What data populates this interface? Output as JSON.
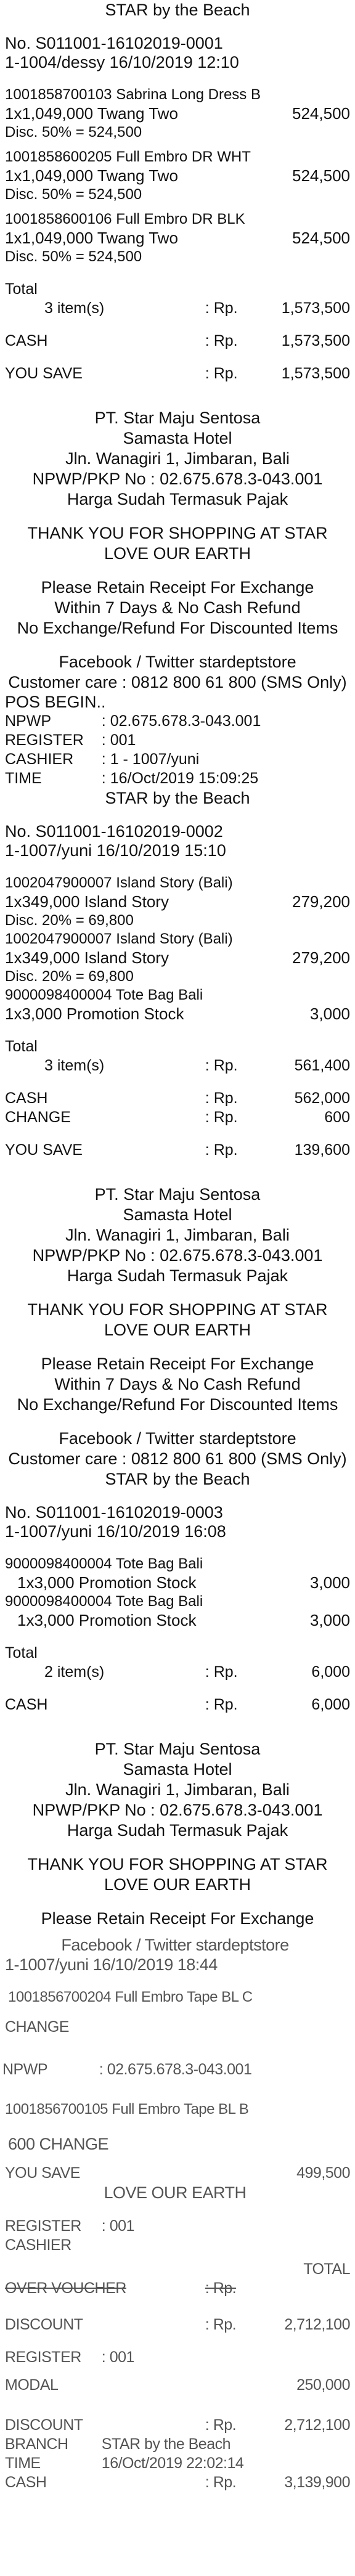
{
  "header_store": "STAR by the Beach",
  "sale1": {
    "no": "No. S011001-16102019-0001",
    "cashier_line": "1-1004/dessy      16/10/2019 12:10",
    "items": [
      {
        "code": "1001858700103 Sabrina Long Dress B",
        "qty_line": "1x1,049,000 Twang Two",
        "amount": "524,500",
        "disc": "Disc. 50% = 524,500"
      },
      {
        "code": "1001858600205 Full Embro DR WHT",
        "qty_line": "1x1,049,000 Twang Two",
        "amount": "524,500",
        "disc": "Disc. 50% = 524,500"
      },
      {
        "code": "1001858600106 Full Embro DR BLK",
        "qty_line": "1x1,049,000 Twang Two",
        "amount": "524,500",
        "disc": "Disc. 50% = 524,500"
      }
    ],
    "total_label": "Total",
    "total_count": "3 item(s)",
    "rp": ": Rp.",
    "total": "1,573,500",
    "cash_label": "CASH",
    "cash": "1,573,500",
    "yousave_label": "YOU SAVE",
    "yousave": "1,573,500"
  },
  "footer1": {
    "company": "PT. Star Maju Sentosa",
    "hotel": "Samasta Hotel",
    "address": "Jln. Wanagiri 1, Jimbaran, Bali",
    "npwp": "NPWP/PKP No : 02.675.678.3-043.001",
    "tax": "Harga Sudah Termasuk Pajak",
    "thanks1": "THANK YOU FOR SHOPPING AT STAR",
    "thanks2": "LOVE OUR EARTH",
    "retain1": "Please Retain Receipt For Exchange",
    "retain2": "Within 7 Days & No Cash Refund",
    "retain3": "No Exchange/Refund For Discounted Items",
    "social": "Facebook / Twitter stardeptstore",
    "care": "Customer care : 0812 800 61 800 (SMS Only)"
  },
  "posbegin": {
    "title": "POS BEGIN..",
    "rows": [
      {
        "k": "NPWP",
        "v": ": 02.675.678.3-043.001"
      },
      {
        "k": "REGISTER",
        "v": ": 001"
      },
      {
        "k": "CASHIER",
        "v": ": 1 - 1007/yuni"
      },
      {
        "k": "TIME",
        "v": ": 16/Oct/2019 15:09:25"
      }
    ],
    "store": "STAR by the Beach"
  },
  "sale2": {
    "no": "No. S011001-16102019-0002",
    "cashier_line": "1-1007/yuni      16/10/2019 15:10",
    "items": [
      {
        "code": "1002047900007 Island Story (Bali)",
        "qty_line": "1x349,000 Island Story",
        "amount": "279,200",
        "disc": "Disc. 20% = 69,800"
      },
      {
        "code": "1002047900007 Island Story (Bali)",
        "qty_line": "1x349,000 Island Story",
        "amount": "279,200",
        "disc": "Disc. 20% = 69,800"
      },
      {
        "code": "9000098400004 Tote Bag Bali",
        "qty_line": "1x3,000 Promotion Stock",
        "amount": "3,000",
        "disc": ""
      }
    ],
    "total_label": "Total",
    "total_count": "3 item(s)",
    "rp": ": Rp.",
    "total": "561,400",
    "cash_label": "CASH",
    "cash": "562,000",
    "change_label": "CHANGE",
    "change": "600",
    "yousave_label": "YOU SAVE",
    "yousave": "139,600"
  },
  "sale3": {
    "no": "No. S011001-16102019-0003",
    "cashier_line": "1-1007/yuni      16/10/2019 16:08",
    "items": [
      {
        "code": "9000098400004 Tote Bag Bali",
        "qty_line": "1x3,000 Promotion Stock",
        "amount": "3,000",
        "disc": ""
      },
      {
        "code": "9000098400004 Tote Bag Bali",
        "qty_line": "1x3,000 Promotion Stock",
        "amount": "3,000",
        "disc": ""
      }
    ],
    "total_label": "Total",
    "total_count": "2 item(s)",
    "rp": ": Rp.",
    "total": "6,000",
    "cash_label": "CASH",
    "cash": "6,000"
  },
  "glitch": {
    "retain_partial": "Please Retain Receipt For Exchange",
    "social_partial": "Facebook / Twitter stardeptstore",
    "cashier_line": "1-1007/yuni      16/10/2019 18:44",
    "item_code": "1001856700204 Full Embro Tape BL C",
    "change_label": "CHANGE",
    "npwp_k": "NPWP",
    "npwp_v": ": 02.675.678.3-043.001",
    "item_code2": "1001856700105 Full Embro Tape BL B",
    "change_row": "600 CHANGE",
    "yousave_label": "YOU SAVE",
    "yousave": "499,500",
    "earth": "LOVE OUR EARTH",
    "register_k": "REGISTER",
    "register_v": ": 001",
    "cashier_k": "CASHIER",
    "total_label": "TOTAL",
    "overvoucher_label": "OVER VOUCHER",
    "rp": ": Rp.",
    "discount_label": "DISCOUNT",
    "discount1": "2,712,100",
    "register_v2": ": 001",
    "modal_label": "MODAL",
    "modal": "250,000",
    "discount2": "2,712,100",
    "branch_label": "BRANCH",
    "branch_v": "STAR by the Beach",
    "time_label": "TIME",
    "time_v": "16/Oct/2019 22:02:14",
    "cash_label": "CASH",
    "cash": "3,139,900"
  }
}
